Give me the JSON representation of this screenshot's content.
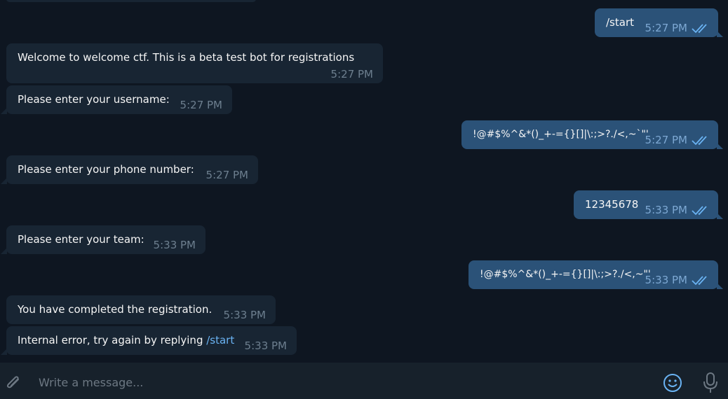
{
  "chat": {
    "messages": [
      {
        "side": "out",
        "text": "/start",
        "is_command": true,
        "time": "5:27 PM",
        "status": "read"
      },
      {
        "side": "in",
        "text": "Welcome to welcome ctf. This is a beta test bot for registrations",
        "time": "5:27 PM"
      },
      {
        "side": "in",
        "text": "Please enter your username:",
        "time": "5:27 PM"
      },
      {
        "side": "out",
        "text": "!@#$%^&*()_+-={}[]|\\:;>?./<,~`\"'",
        "time": "5:27 PM",
        "status": "read"
      },
      {
        "side": "in",
        "text": "Please enter your phone number:",
        "time": "5:27 PM"
      },
      {
        "side": "out",
        "text": "12345678",
        "time": "5:33 PM",
        "status": "read"
      },
      {
        "side": "in",
        "text": "Please enter your team:",
        "time": "5:33 PM"
      },
      {
        "side": "out",
        "text": "!@#$%^&*()_+-={}[]|\\:;>?./<,~\"'",
        "time": "5:33 PM",
        "status": "read"
      },
      {
        "side": "in",
        "text": "You have completed the registration.",
        "time": "5:33 PM"
      },
      {
        "side": "in",
        "text": "Internal error, try again by replying ",
        "link": "/start",
        "time": "5:33 PM"
      }
    ]
  },
  "composer": {
    "placeholder": "Write a message...",
    "attach_icon": "paperclip-icon",
    "emoji_icon": "smiley-icon",
    "mic_icon": "microphone-icon"
  },
  "colors": {
    "background": "#0e1621",
    "incoming_bubble": "#182533",
    "outgoing_bubble": "#2b5278",
    "link": "#6ab3f3",
    "read_check": "#6ab3f3",
    "composer_bg": "#17212b"
  }
}
